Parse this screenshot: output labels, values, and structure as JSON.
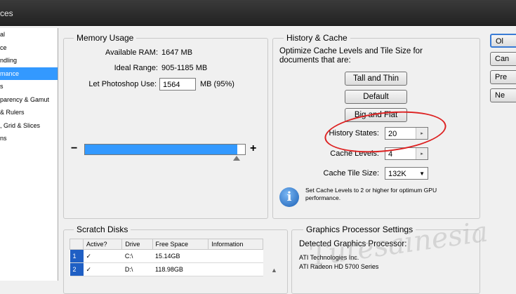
{
  "window": {
    "title_fragment": "ces"
  },
  "sidebar": {
    "items": [
      {
        "label": "al"
      },
      {
        "label": "ce"
      },
      {
        "label": "ndling"
      },
      {
        "label": "mance"
      },
      {
        "label": "s"
      },
      {
        "label": "parency & Gamut"
      },
      {
        "label": "& Rulers"
      },
      {
        "label": ", Grid & Slices"
      },
      {
        "label": "ns"
      }
    ],
    "selected_index": 3
  },
  "memory": {
    "title": "Memory Usage",
    "available_ram_label": "Available RAM:",
    "available_ram_value": "1647 MB",
    "ideal_range_label": "Ideal Range:",
    "ideal_range_value": "905-1185 MB",
    "let_use_label": "Let Photoshop Use:",
    "let_use_value": "1564",
    "let_use_suffix": "MB (95%)",
    "minus": "−",
    "plus": "+",
    "slider_fraction": 0.95
  },
  "history": {
    "title": "History & Cache",
    "description": "Optimize Cache Levels and Tile Size for documents that are:",
    "btn_tall": "Tall and Thin",
    "btn_default": "Default",
    "btn_big": "Big and Flat",
    "history_states_label": "History States:",
    "history_states_value": "20",
    "cache_levels_label": "Cache Levels:",
    "cache_levels_value": "4",
    "cache_tile_label": "Cache Tile Size:",
    "cache_tile_value": "132K",
    "note": "Set Cache Levels to 2 or higher for optimum GPU performance."
  },
  "scratch": {
    "title": "Scratch Disks",
    "columns": [
      "Active?",
      "Drive",
      "Free Space",
      "Information"
    ],
    "rows": [
      {
        "num": "1",
        "active": "✓",
        "drive": "C:\\",
        "free": "15.14GB",
        "info": ""
      },
      {
        "num": "2",
        "active": "✓",
        "drive": "D:\\",
        "free": "118.98GB",
        "info": ""
      }
    ]
  },
  "gpu": {
    "title": "Graphics Processor Settings",
    "detected_label": "Detected Graphics Processor:",
    "vendor": "ATI Technologies Inc.",
    "model": "ATI Radeon HD 5700 Series"
  },
  "right_buttons": [
    "Ol",
    "Can",
    "Pre",
    "Ne"
  ],
  "watermark": "Tutesainesia",
  "colors": {
    "accent": "#3399ff",
    "annotation": "#d22222"
  }
}
